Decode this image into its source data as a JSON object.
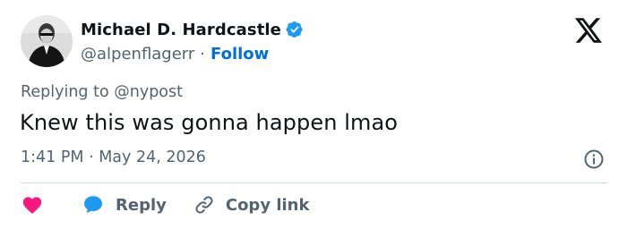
{
  "author": {
    "display_name": "Michael D. Hardcastle",
    "handle": "@alpenflagerr",
    "separator": "·",
    "follow_label": "Follow",
    "verified": true,
    "verified_color": "#1d9bf0"
  },
  "reply_context": {
    "prefix": "Replying to",
    "mention": "@nypost"
  },
  "tweet": {
    "text": "Knew this was gonna happen lmao",
    "timestamp": "1:41 PM · May 24, 2026"
  },
  "actions": {
    "like_icon": "heart-icon",
    "like_color": "#f91880",
    "reply_label": "Reply",
    "reply_icon_color": "#1d9bf0",
    "copy_label": "Copy link"
  },
  "icons": {
    "brand": "x-logo-icon",
    "info": "info-icon",
    "link": "link-icon"
  },
  "colors": {
    "text_primary": "#0f1419",
    "text_secondary": "#536471",
    "link_blue": "#006fd6",
    "divider": "#cfd9de"
  }
}
